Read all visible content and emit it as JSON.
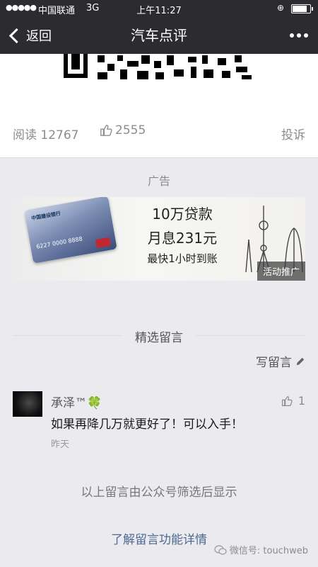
{
  "status_bar": {
    "signal": "●●●●●",
    "carrier": "中国联通",
    "network": "3G",
    "time": "上午11:27"
  },
  "nav": {
    "back_label": "返回",
    "title": "汽车点评"
  },
  "stats": {
    "read": "阅读 12767",
    "likes": "2555",
    "report": "投诉"
  },
  "ad": {
    "label": "广告",
    "card_bank": "中国建设银行",
    "card_number": "6227 0000 8888",
    "line1": "10万贷款",
    "line2": "月息231元",
    "line3": "最快1小时到账",
    "tag": "活动推广"
  },
  "comments_section": {
    "title": "精选留言",
    "write_label": "写留言",
    "items": [
      {
        "author": "承泽™",
        "emoji": "🍀",
        "likes": "1",
        "text": "如果再降几万就更好了！可以入手！",
        "time": "昨天"
      }
    ],
    "footer_note": "以上留言由公众号筛选后显示",
    "learn_more": "了解留言功能详情"
  },
  "watermark": "微信号: touchweb"
}
